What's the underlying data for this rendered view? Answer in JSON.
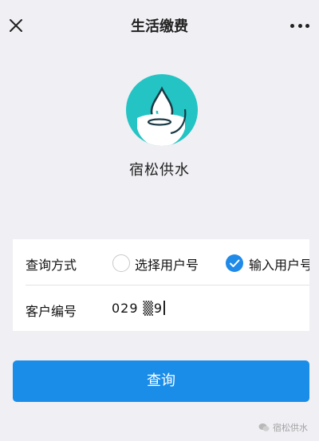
{
  "header": {
    "title": "生活缴费"
  },
  "brand": {
    "name": "宿松供水"
  },
  "form": {
    "method_label": "查询方式",
    "options": [
      {
        "label": "选择用户号",
        "selected": false
      },
      {
        "label": "输入用户号",
        "selected": true
      }
    ],
    "account_label": "客户编号",
    "account_value": "029 ▒9"
  },
  "query_button": {
    "label": "查询"
  },
  "watermark": {
    "text": "宿松供水"
  },
  "colors": {
    "accent": "#1a8de9",
    "logo": "#23c4c3",
    "background": "#efeff4"
  }
}
